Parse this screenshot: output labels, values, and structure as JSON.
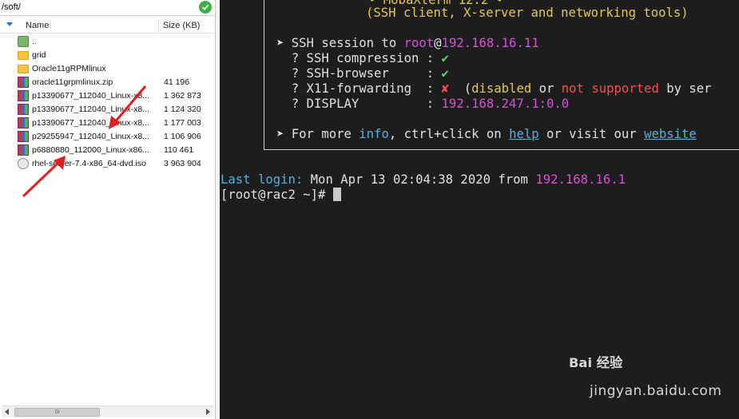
{
  "left_pane": {
    "path": "/soft/",
    "columns": {
      "name": "Name",
      "size": "Size (KB)"
    },
    "files": [
      {
        "icon": "parent-folder-icon",
        "name": "..",
        "size": ""
      },
      {
        "icon": "folder-icon",
        "name": "grid",
        "size": ""
      },
      {
        "icon": "folder-icon",
        "name": "Oracle11gRPMlinux",
        "size": ""
      },
      {
        "icon": "zip-archive-icon",
        "name": "oracle11grpmlinux.zip",
        "size": "41 196"
      },
      {
        "icon": "zip-archive-icon",
        "name": "p13390677_112040_Linux-x8...",
        "size": "1 362 873"
      },
      {
        "icon": "zip-archive-icon",
        "name": "p13390677_112040_Linux-x8...",
        "size": "1 124 320"
      },
      {
        "icon": "zip-archive-icon",
        "name": "p13390677_112040_Linux-x8...",
        "size": "1 177 003"
      },
      {
        "icon": "zip-archive-icon",
        "name": "p29255947_112040_Linux-x8...",
        "size": "1 106 906"
      },
      {
        "icon": "zip-archive-icon",
        "name": "p6880880_112000_Linux-x86...",
        "size": "110 461"
      },
      {
        "icon": "disc-image-icon",
        "name": "rhel-server-7.4-x86_64-dvd.iso",
        "size": "3 963 904"
      }
    ],
    "scrollbar_grip": "III",
    "status_color": "#3cb043"
  },
  "terminal": {
    "banner_top": "• MobaXterm 12.2 •",
    "banner_sub": "(SSH client, X-server and networking tools)",
    "session_prefix": "➤ SSH session to ",
    "session_user": "root",
    "session_at": "@",
    "session_host": "192.168.16.11",
    "compression_label": "  ? SSH compression : ",
    "browser_label": "  ? SSH-browser     : ",
    "x11_label": "  ? X11-forwarding  : ",
    "check_mark": "✔",
    "cross_mark": "✘",
    "x11_open": "  (",
    "x11_disabled": "disabled",
    "x11_or": " or ",
    "x11_not_supported": "not supported",
    "x11_by": " by ser",
    "display_label": "  ? DISPLAY         : ",
    "display_value": "192.168.247.1:0.0",
    "more_prefix": "➤ For more ",
    "more_info": "info",
    "more_mid": ", ctrl+click on ",
    "more_help": "help",
    "more_mid2": " or visit our ",
    "more_website": "website",
    "last_login_label": "Last login: ",
    "last_login_date": "Mon Apr 13 02:04:38 2020 from ",
    "last_login_ip": "192.168.16.1",
    "prompt": "[root@rac2 ~]# "
  },
  "watermark": {
    "brand": "Bai 经验",
    "url": "jingyan.baidu.com"
  },
  "colors": {
    "terminal_bg": "#1d1d1d",
    "yellow": "#e4c84b",
    "magenta": "#d84fd8",
    "green": "#5fd75f",
    "red": "#ff4b4b",
    "cyan": "#4fb3e0",
    "annotation_red": "#e02020"
  }
}
